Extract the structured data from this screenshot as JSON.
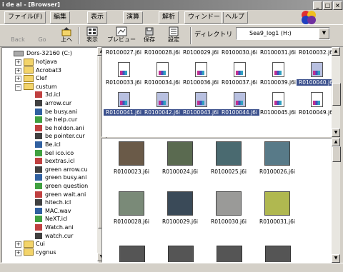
{
  "window": {
    "title": "i de al - [Browser]"
  },
  "menubar": {
    "items": [
      "ファイル(F)",
      "編集",
      "表示",
      "演算",
      "解析",
      "ウィンドー",
      "ヘルプ"
    ]
  },
  "toolbar": {
    "back": "Back",
    "go": "Go",
    "up": "上へ",
    "view": "表示",
    "preview": "プレビュー",
    "save": "保存",
    "settings": "設定",
    "directory_label": "ディレクトリ",
    "directory_value": "Sea9_log1 (H:)"
  },
  "tree": {
    "root": "Dors-32160 (C:)",
    "items": [
      {
        "label": "hotjava",
        "type": "folder"
      },
      {
        "label": "Acrobat3",
        "type": "folder"
      },
      {
        "label": "Clef",
        "type": "folder"
      },
      {
        "label": "custum",
        "type": "folder"
      },
      {
        "label": "3d.icl",
        "type": "file"
      },
      {
        "label": "arrow.cur",
        "type": "file"
      },
      {
        "label": "be busy.ani",
        "type": "file"
      },
      {
        "label": "be help.cur",
        "type": "file"
      },
      {
        "label": "be holdon.ani",
        "type": "file"
      },
      {
        "label": "be pointer.cur",
        "type": "file"
      },
      {
        "label": "Be.icl",
        "type": "file"
      },
      {
        "label": "bel ico.ico",
        "type": "file"
      },
      {
        "label": "bextras.icl",
        "type": "file"
      },
      {
        "label": "green arrow.cu",
        "type": "file"
      },
      {
        "label": "green busy.ani",
        "type": "file"
      },
      {
        "label": "green question",
        "type": "file"
      },
      {
        "label": "green wait.ani",
        "type": "file"
      },
      {
        "label": "hitech.icl",
        "type": "file"
      },
      {
        "label": "MAC.wav",
        "type": "file"
      },
      {
        "label": "NeXT.icl",
        "type": "file"
      },
      {
        "label": "Watch.ani",
        "type": "file"
      },
      {
        "label": "watch.cur",
        "type": "file"
      },
      {
        "label": "Cui",
        "type": "folder"
      },
      {
        "label": "cygnus",
        "type": "folder"
      }
    ]
  },
  "files": {
    "row0": [
      "R0100027.j6i",
      "R0100028.j6i",
      "R0100029.j6i",
      "R0100030.j6i",
      "R0100031.j6i",
      "R0100032.j6i"
    ],
    "row1": [
      "R0100033.j6i",
      "R0100034.j6i",
      "R0100036.j6i",
      "R0100037.j6i",
      "R0100039.j6i",
      "R0100040.j6i"
    ],
    "row2": [
      "R0100041.j6i",
      "R0100042.j6i",
      "R0100043.j6i",
      "R0100044.j6i",
      "R0100045.j6i",
      "R0100049.j6i"
    ],
    "selected_row1": [
      false,
      false,
      false,
      false,
      false,
      true
    ],
    "selected_row2": [
      true,
      true,
      true,
      true,
      false,
      false
    ]
  },
  "thumbnails": {
    "row0": [
      "R0100023.j6i",
      "R0100024.j6i",
      "R0100025.j6i",
      "R0100026.j6i"
    ],
    "row1": [
      "R0100028.j6i",
      "R0100029.j6i",
      "R0100030.j6i",
      "R0100031.j6i"
    ],
    "colors": [
      "#6a5a48",
      "#5a6a50",
      "#4a6a70",
      "#587a88",
      "#7a8a78",
      "#3a4a58",
      "#9a9a98",
      "#b0b850"
    ]
  }
}
